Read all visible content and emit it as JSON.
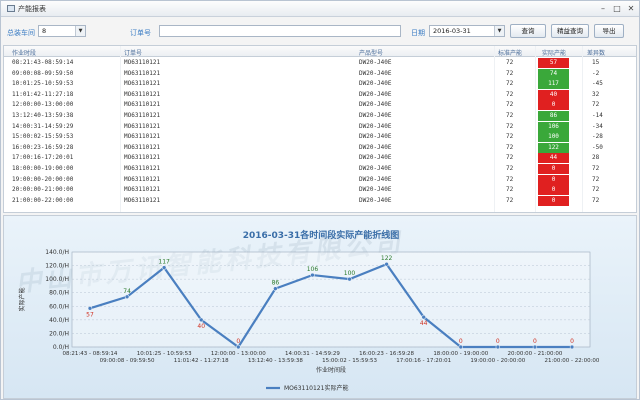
{
  "window": {
    "title": "产能报表",
    "min": "–",
    "max": "□",
    "close": "✕"
  },
  "toolbar": {
    "workshop_label": "总装车间",
    "workshop_value": "8",
    "order_label": "订单号",
    "date_label": "日期",
    "date_value": "2016-03-31",
    "query_button": "查询",
    "detail_query_button": "精益查询",
    "export_button": "导出"
  },
  "table": {
    "columns": [
      "作业时段",
      "订单号",
      "产品型号",
      "标准产能",
      "实际产能",
      "差异数"
    ],
    "rows": [
      [
        "08:21:43-08:59:14",
        "MO63110121",
        "DW20-J40E",
        "72",
        "57",
        "15"
      ],
      [
        "09:00:08-09:59:50",
        "MO63110121",
        "DW20-J40E",
        "72",
        "74",
        "-2"
      ],
      [
        "10:01:25-10:59:53",
        "MO63110121",
        "DW20-J40E",
        "72",
        "117",
        "-45"
      ],
      [
        "11:01:42-11:27:18",
        "MO63110121",
        "DW20-J40E",
        "72",
        "40",
        "32"
      ],
      [
        "12:00:00-13:00:00",
        "MO63110121",
        "DW20-J40E",
        "72",
        "0",
        "72"
      ],
      [
        "13:12:40-13:59:38",
        "MO63110121",
        "DW20-J40E",
        "72",
        "86",
        "-14"
      ],
      [
        "14:00:31-14:59:29",
        "MO63110121",
        "DW20-J40E",
        "72",
        "106",
        "-34"
      ],
      [
        "15:00:02-15:59:53",
        "MO63110121",
        "DW20-J40E",
        "72",
        "100",
        "-28"
      ],
      [
        "16:00:23-16:59:28",
        "MO63110121",
        "DW20-J40E",
        "72",
        "122",
        "-50"
      ],
      [
        "17:00:16-17:20:01",
        "MO63110121",
        "DW20-J40E",
        "72",
        "44",
        "28"
      ],
      [
        "18:00:00-19:00:00",
        "MO63110121",
        "DW20-J40E",
        "72",
        "0",
        "72"
      ],
      [
        "19:00:00-20:00:00",
        "MO63110121",
        "DW20-J40E",
        "72",
        "0",
        "72"
      ],
      [
        "20:00:00-21:00:00",
        "MO63110121",
        "DW20-J40E",
        "72",
        "0",
        "72"
      ],
      [
        "21:00:00-22:00:00",
        "MO63110121",
        "DW20-J40E",
        "72",
        "0",
        "72"
      ]
    ],
    "good_color": "#3aa83a",
    "bad_color": "#e02020"
  },
  "watermark": "中山市万讯智能科技有限公司",
  "chart_data": {
    "type": "line",
    "title": "2016-03-31各时间段实际产能折线图",
    "xlabel": "作业时间段",
    "ylabel": "实际产能",
    "ylim": [
      0,
      140
    ],
    "y_ticks": [
      "0.0/H",
      "20.0/H",
      "40.0/H",
      "60.0/H",
      "80.0/H",
      "100.0/H",
      "120.0/H",
      "140.0/H"
    ],
    "categories": [
      "08:21:43 - 08:59:14",
      "09:00:08 - 09:59:50",
      "10:01:25 - 10:59:53",
      "11:01:42 - 11:27:18",
      "12:00:00 - 13:00:00",
      "13:12:40 - 13:59:38",
      "14:00:31 - 14:59:29",
      "15:00:02 - 15:59:53",
      "16:00:23 - 16:59:28",
      "17:00:16 - 17:20:01",
      "18:00:00 - 19:00:00",
      "19:00:00 - 20:00:00",
      "20:00:00 - 21:00:00",
      "21:00:00 - 22:00:00"
    ],
    "series": [
      {
        "name": "MO63110121实际产能",
        "color": "#4a7fc0",
        "values": [
          57,
          74,
          117,
          40,
          0,
          86,
          106,
          100,
          122,
          44,
          0,
          0,
          0,
          0
        ]
      }
    ],
    "grid": true,
    "legend": "bottom"
  }
}
